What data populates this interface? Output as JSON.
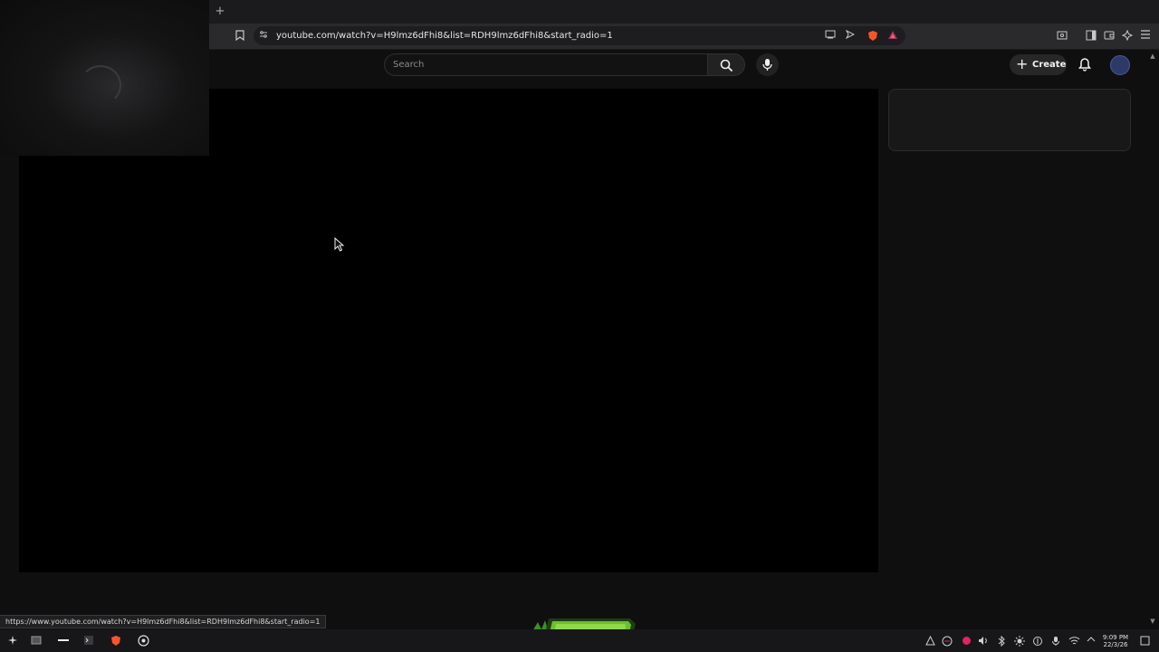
{
  "browser": {
    "new_tab_symbol": "+",
    "url": "youtube.com/watch?v=H9lmz6dFhi8&list=RDH9lmz6dFhi8&start_radio=1",
    "status_url": "https://www.youtube.com/watch?v=H9lmz6dFhi8&list=RDH9lmz6dFhi8&start_radio=1",
    "toolbar_icons": [
      "bookmark-icon",
      "site-info-icon",
      "cast-icon",
      "send-icon",
      "brave-shields-icon",
      "brave-rewards-icon",
      "screenshot-icon",
      "sidebar-icon",
      "wallet-icon",
      "leo-ai-icon",
      "menu-icon"
    ]
  },
  "youtube": {
    "search_placeholder": "Search",
    "create_label": "Create",
    "icons": [
      "search-icon",
      "mic-icon",
      "bell-icon",
      "avatar"
    ]
  },
  "taskbar": {
    "apps": [
      "launcher-icon",
      "screenshot-app-icon",
      "terminal-icon",
      "console-icon",
      "brave-browser-icon",
      "obs-icon"
    ],
    "tray": [
      "notification-icon",
      "brave-tray-icon",
      "record-icon",
      "volume-icon",
      "bluetooth-icon",
      "brightness-icon",
      "vpn-icon",
      "mic-tray-icon",
      "wifi-icon",
      "expand-tray-icon"
    ],
    "time": "9:09 PM",
    "date": "22/3/26"
  },
  "colors": {
    "page_bg": "#0f0f0f",
    "player_bg": "#000000",
    "record_red": "#e0245e"
  }
}
